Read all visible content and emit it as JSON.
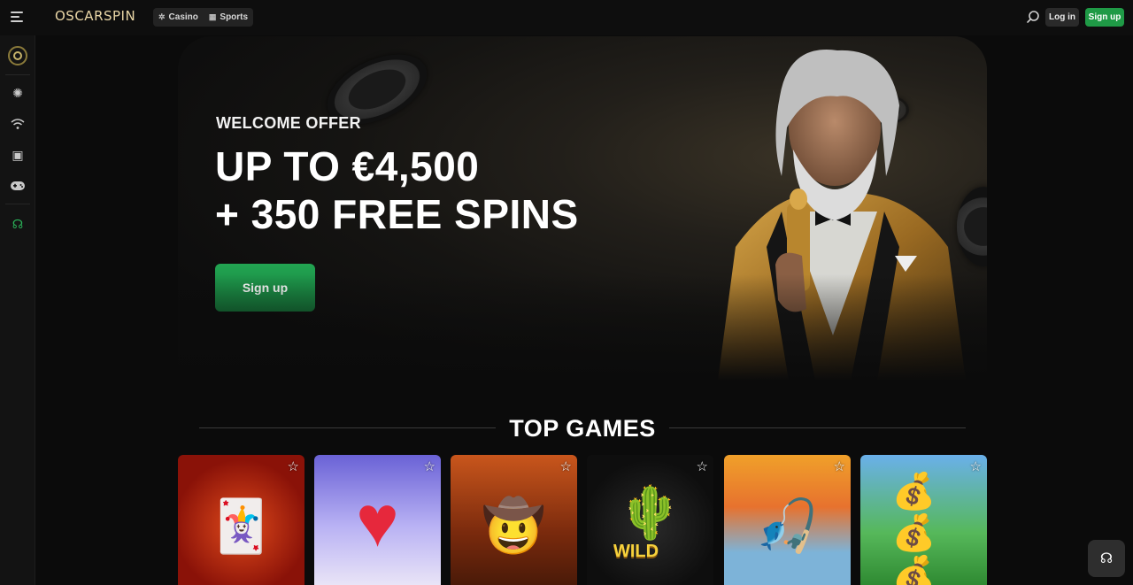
{
  "header": {
    "logo": "OSCARSPIN",
    "nav": [
      {
        "label": "Casino",
        "icon": "chip-icon"
      },
      {
        "label": "Sports",
        "icon": "grid-icon"
      }
    ],
    "login_label": "Log in",
    "signup_label": "Sign up"
  },
  "sidebar": {
    "items": [
      {
        "icon": "brand-ring-icon"
      },
      {
        "icon": "casino-chip-icon"
      },
      {
        "icon": "live-signal-icon"
      },
      {
        "icon": "slots-icon"
      },
      {
        "icon": "gamepad-icon"
      },
      {
        "icon": "headset-icon"
      }
    ]
  },
  "hero": {
    "eyebrow": "WELCOME OFFER",
    "line1": "UP TO €4,500",
    "line2": "+ 350 FREE SPINS",
    "cta_label": "Sign up"
  },
  "top_games": {
    "title": "TOP GAMES",
    "cards": [
      {
        "art": "jester-face"
      },
      {
        "art": "heart"
      },
      {
        "art": "explorer"
      },
      {
        "art": "cactus-wild",
        "badge": "WILD"
      },
      {
        "art": "fisherman"
      },
      {
        "art": "pots-of-gold"
      }
    ]
  },
  "colors": {
    "accent_green": "#1f9a46",
    "logo_gold": "#e9d6a6",
    "background": "#0b0b0b"
  }
}
